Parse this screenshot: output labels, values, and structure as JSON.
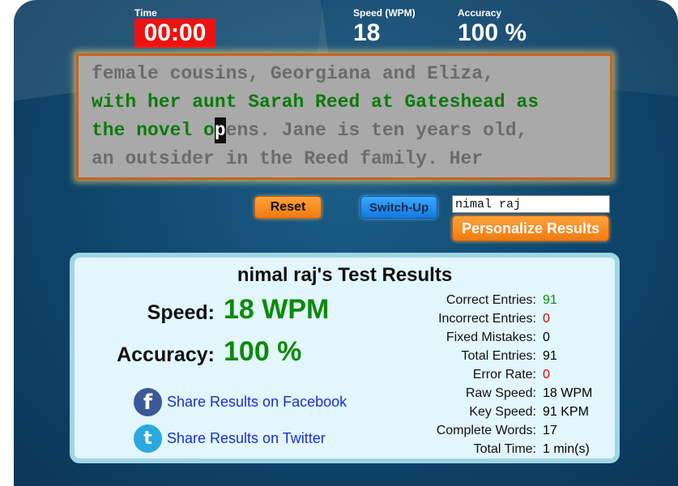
{
  "header": {
    "time_label": "Time",
    "time_value": "00:00",
    "speed_label": "Speed (WPM)",
    "speed_value": "18",
    "accuracy_label": "Accuracy",
    "accuracy_value": "100 %"
  },
  "typing": {
    "line1": "female cousins, Georgiana and Eliza,",
    "line2_typed": "with her aunt Sarah Reed at Gateshead as",
    "line3_typed": "the novel o",
    "line3_cursor": "p",
    "line3_rest": "ens. Jane is ten years old,",
    "line4": "an outsider in the Reed family. Her"
  },
  "controls": {
    "reset_label": "Reset",
    "switch_label": "Switch-Up",
    "name_value": "nimal raj",
    "personalize_label": "Personalize Results"
  },
  "results": {
    "title": "nimal raj's Test Results",
    "speed_label": "Speed:",
    "speed_value": "18 WPM",
    "accuracy_label": "Accuracy:",
    "accuracy_value": "100 %",
    "share_facebook": "Share Results on Facebook",
    "share_twitter": "Share Results on Twitter",
    "facebook_icon": "f",
    "twitter_icon": "t",
    "stats": [
      {
        "label": "Correct Entries:",
        "value": "91",
        "color": "green"
      },
      {
        "label": "Incorrect Entries:",
        "value": "0",
        "color": "red"
      },
      {
        "label": "Fixed Mistakes:",
        "value": "0",
        "color": ""
      },
      {
        "label": "Total Entries:",
        "value": "91",
        "color": ""
      },
      {
        "label": "Error Rate:",
        "value": "0",
        "color": "red"
      },
      {
        "label": "Raw Speed:",
        "value": "18 WPM",
        "color": ""
      },
      {
        "label": "Key Speed:",
        "value": "91 KPM",
        "color": ""
      },
      {
        "label": "Complete Words:",
        "value": "17",
        "color": ""
      },
      {
        "label": "Total Time:",
        "value": "1 min(s)",
        "color": ""
      }
    ]
  }
}
